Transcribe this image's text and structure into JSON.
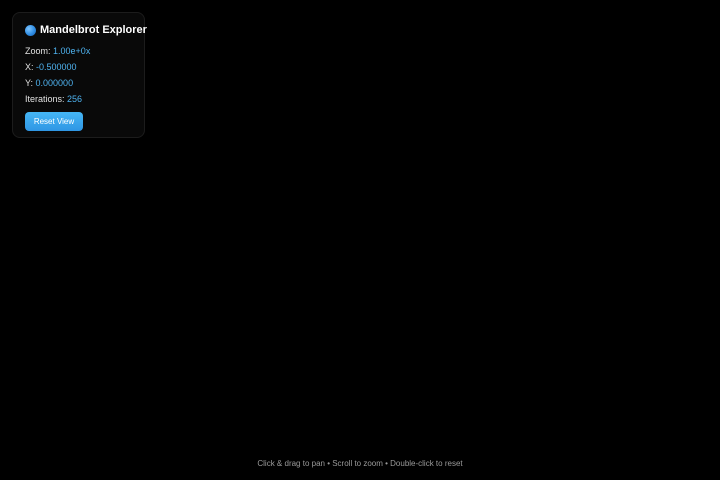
{
  "panel": {
    "title": "Mandelbrot Explorer",
    "icon": "globe-icon",
    "zoom_label": "Zoom:",
    "zoom_value": "1.00e+0x",
    "x_label": "X:",
    "x_value": "-0.500000",
    "y_label": "Y:",
    "y_value": "0.000000",
    "iterations_label": "Iterations:",
    "iterations_value": "256",
    "reset_label": "Reset View"
  },
  "hint": "Click & drag to pan • Scroll to zoom • Double-click to reset",
  "colors": {
    "background": "#000000",
    "accent": "#4fb3f0",
    "button": "#3aa6ef"
  }
}
